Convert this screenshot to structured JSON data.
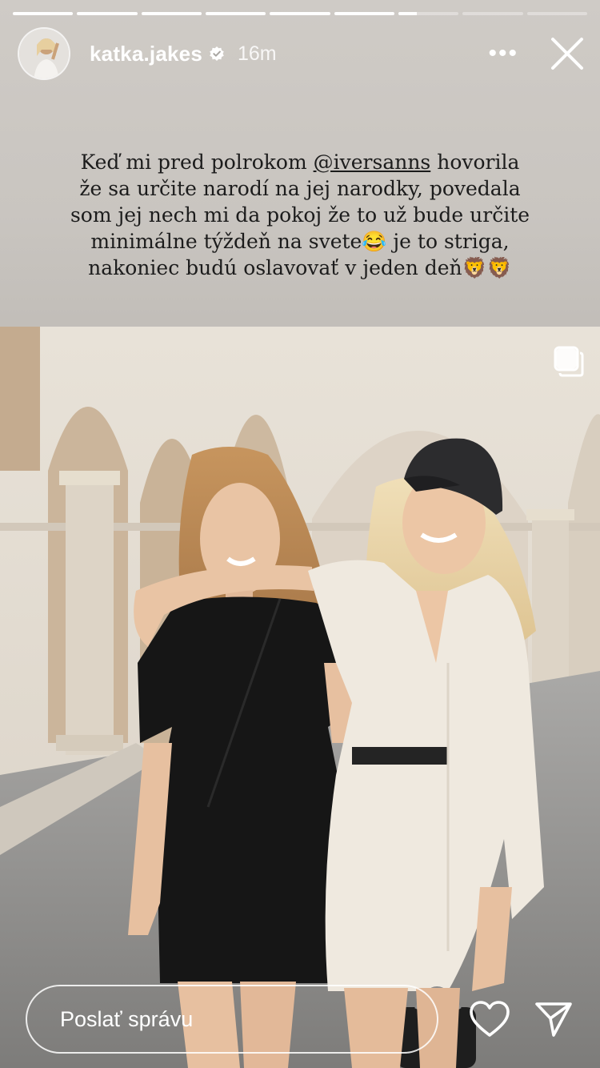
{
  "story": {
    "progress_segments": [
      1,
      1,
      1,
      1,
      1,
      1,
      0.3,
      0,
      0
    ]
  },
  "header": {
    "username": "katka.jakes",
    "time": "16m",
    "more_glyph": "•••",
    "verified_icon": "verified-badge-icon",
    "close_icon": "close-icon"
  },
  "caption": {
    "line1_before": "Keď mi pred polrokom ",
    "mention": "@iversanns",
    "line1_after": " hovorila",
    "line2": "že sa určite narodí na jej narodky, povedala",
    "line3": "som jej nech mi da pokoj že to už bude určite",
    "line4": "minimálne týždeň na svete😂 je to striga,",
    "line5": "nakoniec budú oslavovať v jeden deň🦁🦁"
  },
  "footer": {
    "message_placeholder": "Poslať správu",
    "like_icon": "heart-icon",
    "send_icon": "send-icon"
  },
  "colors": {
    "background": "#cfcbc6",
    "caption_text": "#1c1c1c",
    "white": "#ffffff"
  }
}
